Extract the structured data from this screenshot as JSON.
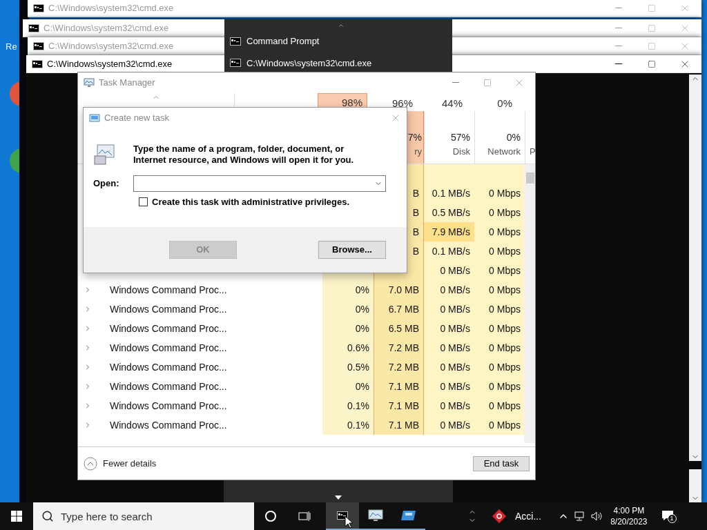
{
  "desktop": {
    "icon_labels": [
      "Re"
    ]
  },
  "cmd_windows": [
    {
      "title": "C:\\Windows\\system32\\cmd.exe",
      "active": false
    },
    {
      "title": "C:\\Windows\\system32\\cmd.exe",
      "active": false
    },
    {
      "title": "C:\\Windows\\system32\\cmd.exe",
      "active": false
    },
    {
      "title": "C:\\Windows\\system32\\cmd.exe",
      "active": true
    }
  ],
  "thumbnail_popup": {
    "items": [
      "Command Prompt",
      "C:\\Windows\\system32\\cmd.exe"
    ]
  },
  "task_manager": {
    "title": "Task Manager",
    "summary": [
      {
        "text": "98%",
        "hot": true
      },
      {
        "text": "96%",
        "hot": false
      },
      {
        "text": "44%",
        "hot": false
      },
      {
        "text": "0%",
        "hot": false
      }
    ],
    "headers": [
      {
        "value": "7%",
        "label": "ry",
        "hot": true
      },
      {
        "value": "57%",
        "label": "Disk",
        "hot": false
      },
      {
        "value": "0%",
        "label": "Network",
        "hot": false
      },
      {
        "label": "P",
        "hot": false
      }
    ],
    "rows": [
      {
        "kind": "group"
      },
      {
        "kind": "process",
        "memory": "B",
        "disk": "0.1 MB/s",
        "network": "0 Mbps",
        "disk_hot": false
      },
      {
        "kind": "process",
        "memory": "B",
        "disk": "0.5 MB/s",
        "network": "0 Mbps",
        "disk_hot": false
      },
      {
        "kind": "process",
        "memory": "B",
        "disk": "7.9 MB/s",
        "network": "0 Mbps",
        "disk_hot": true
      },
      {
        "kind": "process",
        "memory": "B",
        "disk": "0.1 MB/s",
        "network": "0 Mbps",
        "disk_hot": false
      },
      {
        "kind": "process",
        "disk": "0 MB/s",
        "network": "0 Mbps",
        "disk_hot": false
      },
      {
        "kind": "process",
        "name": "Windows Command Proc...",
        "cpu": "0%",
        "memory": "7.0 MB",
        "disk": "0 MB/s",
        "network": "0 Mbps",
        "disk_hot": false
      },
      {
        "kind": "process",
        "name": "Windows Command Proc...",
        "cpu": "0%",
        "memory": "6.7 MB",
        "disk": "0 MB/s",
        "network": "0 Mbps",
        "disk_hot": false
      },
      {
        "kind": "process",
        "name": "Windows Command Proc...",
        "cpu": "0%",
        "memory": "6.5 MB",
        "disk": "0 MB/s",
        "network": "0 Mbps",
        "disk_hot": false
      },
      {
        "kind": "process",
        "name": "Windows Command Proc...",
        "cpu": "0.6%",
        "memory": "7.2 MB",
        "disk": "0 MB/s",
        "network": "0 Mbps",
        "disk_hot": false
      },
      {
        "kind": "process",
        "name": "Windows Command Proc...",
        "cpu": "0.5%",
        "memory": "7.2 MB",
        "disk": "0 MB/s",
        "network": "0 Mbps",
        "disk_hot": false
      },
      {
        "kind": "process",
        "name": "Windows Command Proc...",
        "cpu": "0%",
        "memory": "7.1 MB",
        "disk": "0 MB/s",
        "network": "0 Mbps",
        "disk_hot": false
      },
      {
        "kind": "process",
        "name": "Windows Command Proc...",
        "cpu": "0.1%",
        "memory": "7.1 MB",
        "disk": "0 MB/s",
        "network": "0 Mbps",
        "disk_hot": false
      },
      {
        "kind": "process",
        "name": "Windows Command Proc...",
        "cpu": "0.1%",
        "memory": "7.1 MB",
        "disk": "0 MB/s",
        "network": "0 Mbps",
        "disk_hot": false
      }
    ],
    "fewer_details": "Fewer details",
    "end_task": "End task"
  },
  "dialog": {
    "title": "Create new task",
    "message": "Type the name of a program, folder, document, or Internet resource, and Windows will open it for you.",
    "open_label": "Open:",
    "admin_checkbox": {
      "label": "Create this task with administrative privileges.",
      "checked": false
    },
    "ok": {
      "label": "OK",
      "disabled": true
    },
    "browse": "Browse..."
  },
  "taskbar": {
    "search": {
      "placeholder": "Type here to search"
    },
    "apps": [
      {
        "kind": "cmd",
        "active": true
      },
      {
        "kind": "taskmgr",
        "active": false
      },
      {
        "kind": "run",
        "active": false
      }
    ],
    "tray_app": "Acci...",
    "time": "4:00 PM",
    "date": "8/20/2023",
    "notification_count": "1"
  }
}
